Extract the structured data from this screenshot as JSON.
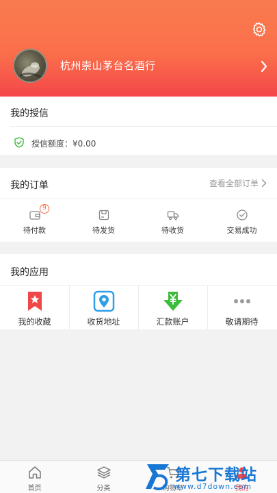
{
  "header": {
    "shop_name": "杭州崇山茅台名酒行",
    "settings_icon": "gear-icon",
    "avatar": "avatar-image"
  },
  "credit": {
    "title": "我的授信",
    "label": "授信额度：¥0.00"
  },
  "orders": {
    "title": "我的订单",
    "view_all": "查看全部订单",
    "items": [
      {
        "label": "待付款",
        "icon": "wallet-icon",
        "badge": "9"
      },
      {
        "label": "待发货",
        "icon": "box-icon"
      },
      {
        "label": "待收货",
        "icon": "truck-icon"
      },
      {
        "label": "交易成功",
        "icon": "check-circle-icon"
      }
    ]
  },
  "apps": {
    "title": "我的应用",
    "items": [
      {
        "label": "我的收藏",
        "icon": "bookmark-star-icon",
        "color": "#f04848"
      },
      {
        "label": "收货地址",
        "icon": "location-pin-icon",
        "color": "#2d9ee8"
      },
      {
        "label": "汇款账户",
        "icon": "yen-download-icon",
        "color": "#3dbb3a"
      },
      {
        "label": "敬请期待",
        "icon": "more-dots-icon",
        "color": "#9a9a9a"
      }
    ]
  },
  "tabbar": {
    "items": [
      {
        "label": "首页",
        "icon": "home-icon"
      },
      {
        "label": "分类",
        "icon": "layers-icon"
      },
      {
        "label": "购物车",
        "icon": "cart-icon"
      },
      {
        "label": "我的",
        "icon": "user-icon"
      }
    ]
  },
  "watermark": {
    "title": "第七下载站",
    "url": "www.d7down.com"
  },
  "colors": {
    "accent": "#f4474a",
    "header_top": "#f97b4f",
    "watermark": "#1777d4"
  }
}
